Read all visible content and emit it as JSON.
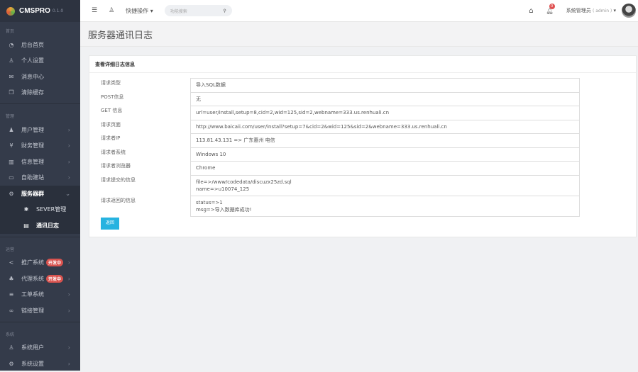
{
  "app": {
    "name": "CMSPRO",
    "version": "0.1.0"
  },
  "sidebar": {
    "sections": [
      {
        "title": "首页",
        "items": [
          {
            "label": "后台首页",
            "icon": "dashboard-icon"
          },
          {
            "label": "个人设置",
            "icon": "user-icon"
          },
          {
            "label": "消息中心",
            "icon": "mail-icon"
          },
          {
            "label": "清除缓存",
            "icon": "copy-icon"
          }
        ]
      },
      {
        "title": "管理",
        "items": [
          {
            "label": "用户管理",
            "icon": "users-icon"
          },
          {
            "label": "财务管理",
            "icon": "yen-icon"
          },
          {
            "label": "信息管理",
            "icon": "columns-icon"
          },
          {
            "label": "自助建站",
            "icon": "monitor-icon"
          },
          {
            "label": "服务器群",
            "icon": "cogs-icon"
          }
        ],
        "subitems": [
          {
            "label": "SEVER管理"
          },
          {
            "label": "通讯日志"
          }
        ]
      },
      {
        "title": "运营",
        "items": [
          {
            "label": "推广系统",
            "badge": "开发中"
          },
          {
            "label": "代理系统",
            "badge": "开发中"
          },
          {
            "label": "工单系统"
          },
          {
            "label": "链接管理"
          }
        ]
      },
      {
        "title": "系统",
        "items": [
          {
            "label": "系统用户"
          },
          {
            "label": "系统设置"
          }
        ]
      }
    ]
  },
  "topbar": {
    "quick_ops": "快捷操作",
    "search_placeholder": "功能搜索",
    "notifications": "0",
    "user": "系统管理员",
    "role": "( admin )"
  },
  "page": {
    "title": "服务器通讯日志",
    "panel_title": "查看详细日志信息",
    "back_label": "返回"
  },
  "fields": [
    {
      "label": "请求类型",
      "value": "导入SQL数据"
    },
    {
      "label": "POST信息",
      "value": "无"
    },
    {
      "label": "GET  信息",
      "value": "url=user/install,setup=8,cid=2,wid=125,sid=2,webname=333.us.renhuali.cn"
    },
    {
      "label": "请求页面",
      "value": "http://www.baicaii.com/user/install?setup=7&cid=2&wid=125&sid=2&webname=333.us.renhuali.cn"
    },
    {
      "label": "请求者IP",
      "value": "113.81.43.131 => 广东惠州 电信"
    },
    {
      "label": "请求者系统",
      "value": "Windows 10"
    },
    {
      "label": "请求者浏览器",
      "value": "Chrome"
    },
    {
      "label": "请求提交的信息",
      "value": "file=>/www/codedata/discuzx25zd.sql\nname=>u10074_125"
    },
    {
      "label": "请求返回的信息",
      "value": "status=>1\nmsg=>导入数据库成功!"
    }
  ]
}
